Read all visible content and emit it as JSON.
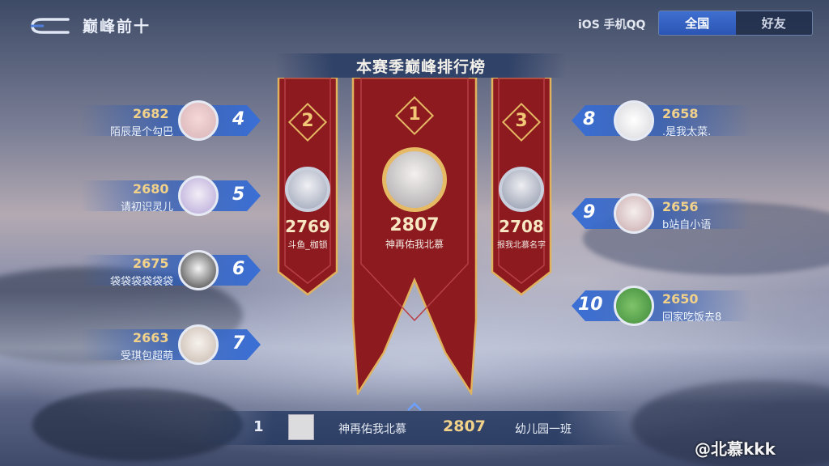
{
  "header": {
    "title": "巅峰前十",
    "platform": "iOS 手机QQ",
    "tabs": [
      {
        "label": "全国",
        "active": true
      },
      {
        "label": "好友",
        "active": false
      }
    ]
  },
  "board": {
    "title": "本赛季巅峰排行榜",
    "podium": [
      {
        "rank": "1",
        "score": "2807",
        "name": "神再佑我北慕"
      },
      {
        "rank": "2",
        "score": "2769",
        "name": "斗鱼_枷锁"
      },
      {
        "rank": "3",
        "score": "2708",
        "name": "报我北慕名字"
      }
    ],
    "left": [
      {
        "rank": "4",
        "score": "2682",
        "name": "陌辰是个勾巴"
      },
      {
        "rank": "5",
        "score": "2680",
        "name": "请初识灵儿"
      },
      {
        "rank": "6",
        "score": "2675",
        "name": "袋袋袋袋袋袋"
      },
      {
        "rank": "7",
        "score": "2663",
        "name": "受琪包超萌"
      }
    ],
    "right": [
      {
        "rank": "8",
        "score": "2658",
        "name": ".是我太菜."
      },
      {
        "rank": "9",
        "score": "2656",
        "name": "b站自小语"
      },
      {
        "rank": "10",
        "score": "2650",
        "name": "回家吃饭去8"
      }
    ]
  },
  "self_row": {
    "rank": "1",
    "name": "神再佑我北慕",
    "score": "2807",
    "team": "幼儿园一班"
  },
  "watermark": "@北慕kkk",
  "colors": {
    "banner_red": "#8c1a1f",
    "gold": "#e6b964",
    "entry_blue": "#2f5db8",
    "tab_active": "#3f6fd0"
  }
}
